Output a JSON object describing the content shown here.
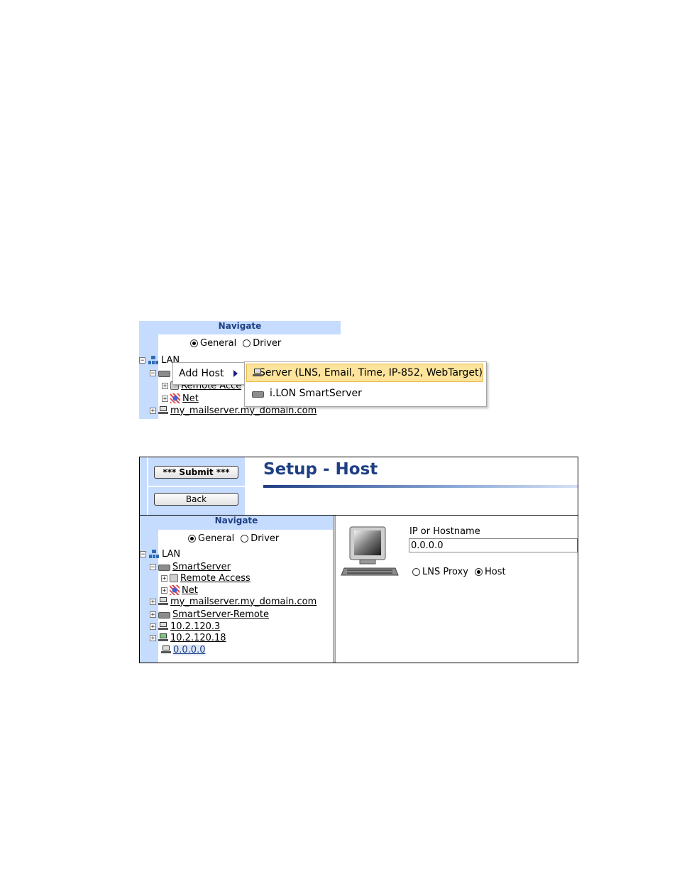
{
  "shot1": {
    "nav_title": "Navigate",
    "view_mode": {
      "general": "General",
      "driver": "Driver",
      "selected": "General"
    },
    "tree": {
      "lan": "LAN",
      "remote_access": "Remote Acce",
      "net": "Net",
      "mailserver": "my_mailserver.my_domain.com"
    },
    "context_menu": {
      "add_host": "Add Host"
    },
    "submenu": {
      "server": "Server (LNS, Email, Time, IP-852, WebTarget)",
      "smartserver": "i.LON SmartServer"
    },
    "colors": {
      "nav_bg": "#c6dcff",
      "highlight": "#fde39c",
      "title": "#1f3f84"
    }
  },
  "shot2": {
    "submit_label": "*** Submit ***",
    "back_label": "Back",
    "page_title": "Setup - Host",
    "nav_title": "Navigate",
    "view_mode": {
      "general": "General",
      "driver": "Driver",
      "selected": "General"
    },
    "tree": {
      "lan": "LAN",
      "smartserver": "SmartServer",
      "remote_access": "Remote Access",
      "net": "Net",
      "mailserver": "my_mailserver.my_domain.com",
      "smartserver_remote": "SmartServer-Remote",
      "host1": "10.2.120.3",
      "host2": "10.2.120.18",
      "host3": "0.0.0.0"
    },
    "form": {
      "ip_label": "IP or Hostname",
      "ip_value": "0.0.0.0",
      "lns_proxy": "LNS Proxy",
      "host": "Host",
      "selected_type": "Host"
    }
  }
}
